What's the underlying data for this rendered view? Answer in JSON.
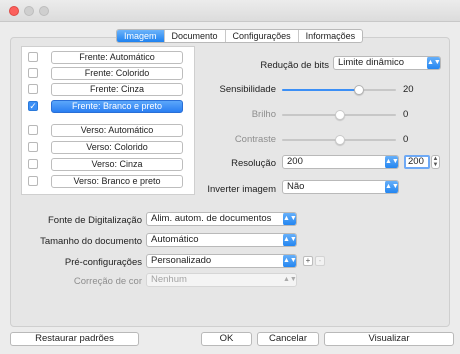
{
  "window": {
    "title": ""
  },
  "tabs": [
    {
      "label": "Imagem",
      "active": true
    },
    {
      "label": "Documento",
      "active": false
    },
    {
      "label": "Configurações",
      "active": false
    },
    {
      "label": "Informações",
      "active": false
    }
  ],
  "profiles": [
    {
      "label": "Frente: Automático",
      "checked": false,
      "selected": false
    },
    {
      "label": "Frente: Colorido",
      "checked": false,
      "selected": false
    },
    {
      "label": "Frente: Cinza",
      "checked": false,
      "selected": false
    },
    {
      "label": "Frente: Branco e preto",
      "checked": true,
      "selected": true
    },
    {
      "label": "Verso: Automático",
      "checked": false,
      "selected": false
    },
    {
      "label": "Verso: Colorido",
      "checked": false,
      "selected": false
    },
    {
      "label": "Verso: Cinza",
      "checked": false,
      "selected": false
    },
    {
      "label": "Verso: Branco e preto",
      "checked": false,
      "selected": false
    }
  ],
  "image": {
    "bit_reduction": {
      "label": "Redução de bits",
      "value": "Limite dinâmico"
    },
    "sensitivity": {
      "label": "Sensibilidade",
      "value": "20",
      "level": 0.6
    },
    "brightness": {
      "label": "Brilho",
      "value": "0",
      "level": 0.5
    },
    "contrast": {
      "label": "Contraste",
      "value": "0",
      "level": 0.5
    },
    "resolution": {
      "label": "Resolução",
      "value": "200",
      "custom": "200"
    },
    "invert": {
      "label": "Inverter imagem",
      "value": "Não"
    }
  },
  "document": {
    "source": {
      "label": "Fonte de Digitalização",
      "value": "Alim. autom. de documentos"
    },
    "size": {
      "label": "Tamanho do documento",
      "value": "Automático"
    },
    "presets": {
      "label": "Pré-configurações",
      "value": "Personalizado",
      "add": "+",
      "remove": "-"
    },
    "color_correction": {
      "label": "Correção de cor",
      "value": "Nenhum"
    }
  },
  "buttons": {
    "restore": "Restaurar padrões",
    "ok": "OK",
    "cancel": "Cancelar",
    "preview": "Visualizar"
  },
  "colors": {
    "accent": "#2a7ef2",
    "close": "#fc605c"
  }
}
